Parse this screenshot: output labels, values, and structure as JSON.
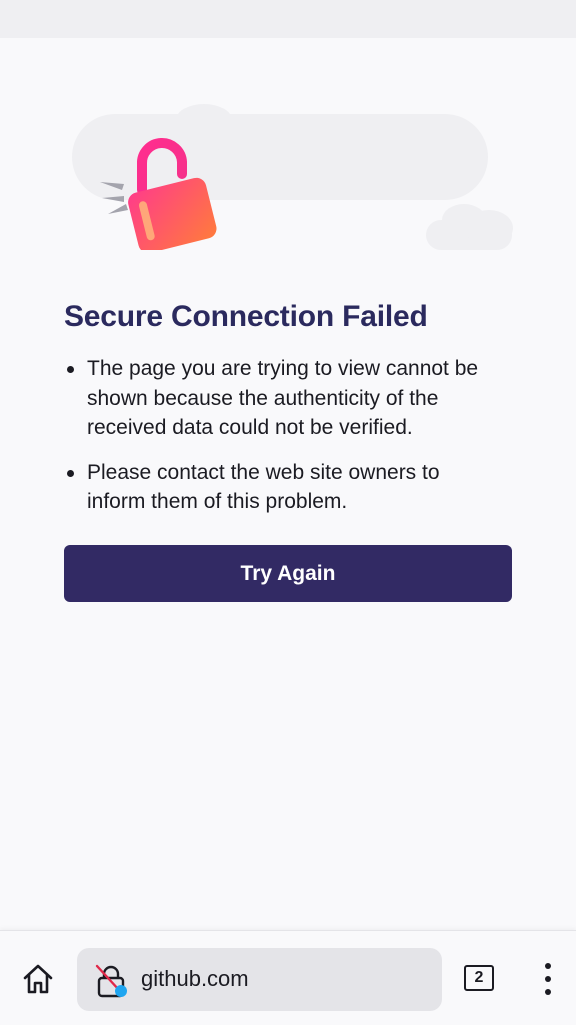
{
  "error": {
    "title": "Secure Connection Failed",
    "bullets": [
      "The page you are trying to view cannot be shown because the authenticity of the received data could not be verified.",
      "Please contact the web site owners to inform them of this problem."
    ],
    "try_again_label": "Try Again"
  },
  "toolbar": {
    "url": "github.com",
    "tab_count": "2",
    "home_icon": "home-icon",
    "security_icon": "insecure-lock-icon",
    "menu_icon": "kebab-menu-icon"
  },
  "colors": {
    "title": "#2b2a5e",
    "button": "#322a64",
    "lock_gradient_start": "#ff3c8a",
    "lock_gradient_end": "#ff7b3c",
    "insecure_dot": "#1fa5f0"
  }
}
